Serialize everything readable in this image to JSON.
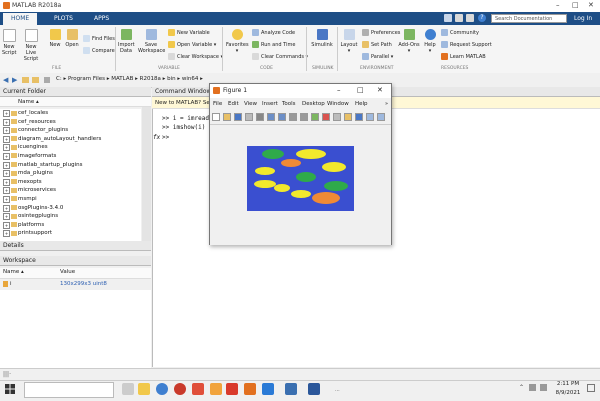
{
  "window": {
    "title": "MATLAB R2018a"
  },
  "tabs": [
    {
      "label": "HOME"
    },
    {
      "label": "PLOTS"
    },
    {
      "label": "APPS"
    }
  ],
  "search": {
    "placeholder": "Search Documentation"
  },
  "login": "Log In",
  "ribbon": {
    "new_script": "New Script",
    "new_live_script": "New Live Script",
    "new": "New",
    "open": "Open",
    "find_files": "Find Files",
    "compare": "Compare",
    "import_data": "Import Data",
    "save_workspace": "Save Workspace",
    "new_variable": "New Variable",
    "open_variable": "Open Variable",
    "clear_workspace": "Clear Workspace",
    "favorites": "Favorites",
    "analyze_code": "Analyze Code",
    "run_and_time": "Run and Time",
    "clear_commands": "Clear Commands",
    "simulink": "Simulink",
    "layout": "Layout",
    "preferences": "Preferences",
    "set_path": "Set Path",
    "parallel": "Parallel",
    "add_ons": "Add-Ons",
    "help": "Help",
    "community": "Community",
    "request_support": "Request Support",
    "learn_matlab": "Learn MATLAB",
    "sections": {
      "file": "FILE",
      "variable": "VARIABLE",
      "code": "CODE",
      "simulink": "SIMULINK",
      "environment": "ENVIRONMENT",
      "resources": "RESOURCES"
    }
  },
  "address": {
    "path": "C: ▸ Program Files ▸ MATLAB ▸ R2018a ▸ bin ▸ win64 ▸"
  },
  "current_folder": {
    "title": "Current Folder",
    "column": "Name ▴",
    "items": [
      "cef_locales",
      "cef_resources",
      "connector_plugins",
      "diagram_autoLayout_handlers",
      "icuengines",
      "imageformats",
      "matlab_startup_plugins",
      "mda_plugins",
      "mexopts",
      "microservices",
      "msmpi",
      "osgPlugins-3.4.0",
      "osintegplugins",
      "platforms",
      "printsupport"
    ]
  },
  "details": {
    "title": "Details"
  },
  "workspace": {
    "title": "Workspace",
    "col_name": "Name ▴",
    "col_value": "Value",
    "rows": [
      {
        "name": "i",
        "value": "130x299x3 uint8"
      }
    ]
  },
  "command_window": {
    "title": "Command Window",
    "notice": "New to MATLAB? See",
    "lines": [
      ">> i = imread",
      ">> imshow(i)"
    ],
    "prompt": ">>",
    "fx": "fx"
  },
  "figure": {
    "title": "Figure 1",
    "menu": [
      "File",
      "Edit",
      "View",
      "Insert",
      "Tools",
      "Desktop",
      "Window",
      "Help"
    ],
    "image_bg": "#3a4fd0",
    "blobs": [
      {
        "color": "#2faa4a"
      },
      {
        "color": "#f2e92c"
      },
      {
        "color": "#f2e92c"
      },
      {
        "color": "#f08a35"
      },
      {
        "color": "#f2e92c"
      },
      {
        "color": "#2faa4a"
      },
      {
        "color": "#f2e92c"
      },
      {
        "color": "#f2e92c"
      },
      {
        "color": "#2faa4a"
      },
      {
        "color": "#f08a35"
      },
      {
        "color": "#f2e92c"
      }
    ]
  },
  "taskbar": {
    "time": "2:11 PM",
    "date": "8/9/2021"
  },
  "colors": {
    "tabbar": "#1e4e86",
    "accent": "#e2701f"
  }
}
